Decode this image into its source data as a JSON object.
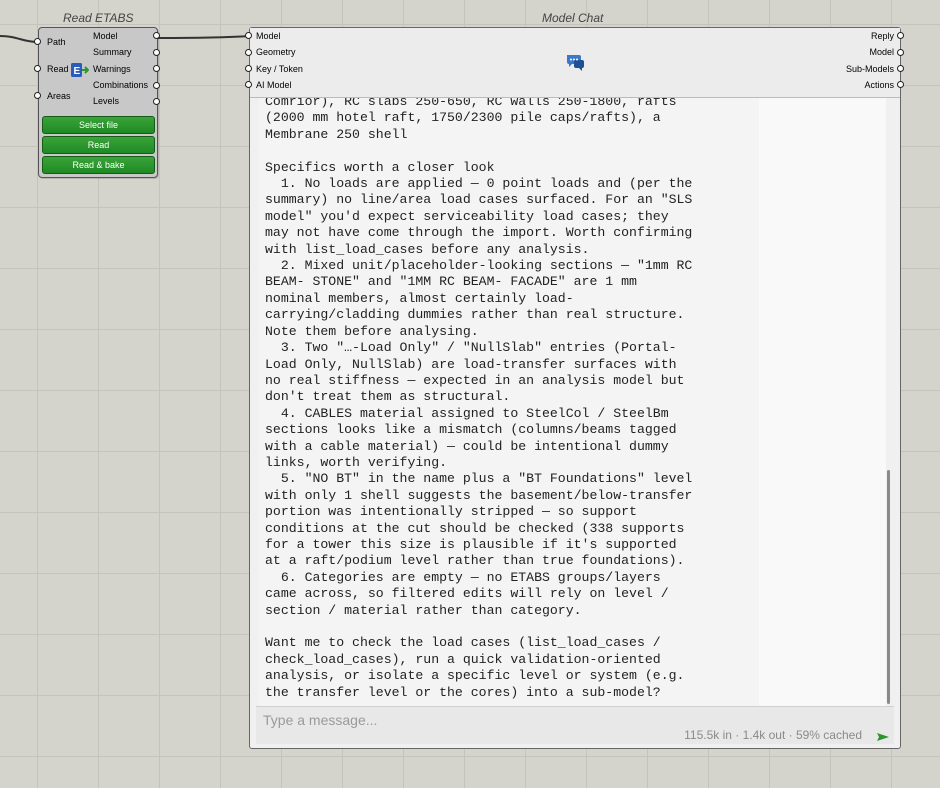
{
  "read_etabs": {
    "title": "Read ETABS",
    "inputs": [
      "Path",
      "Read",
      "Areas"
    ],
    "outputs": [
      "Model",
      "Summary",
      "Warnings",
      "Combinations",
      "Levels"
    ],
    "buttons": [
      "Select file",
      "Read",
      "Read & bake"
    ],
    "icon": "etabs-export-icon"
  },
  "model_chat": {
    "title": "Model Chat",
    "inputs": [
      "Model",
      "Geometry",
      "Key / Token",
      "AI Model"
    ],
    "outputs": [
      "Reply",
      "Model",
      "Sub-Models",
      "Actions"
    ],
    "icon": "chat-bubbles-icon",
    "transcript_lines": [
      "Comrior), RC slabs 250-650, RC walls 250-1800, rafts",
      "(2000 mm hotel raft, 1750/2300 pile caps/rafts), a",
      "Membrane 250 shell",
      "",
      "Specifics worth a closer look",
      "  1. No loads are applied — 0 point loads and (per the",
      "summary) no line/area load cases surfaced. For an \"SLS",
      "model\" you'd expect serviceability load cases; they",
      "may not have come through the import. Worth confirming",
      "with list_load_cases before any analysis.",
      "  2. Mixed unit/placeholder-looking sections — \"1mm RC",
      "BEAM- STONE\" and \"1MM RC BEAM- FACADE\" are 1 mm",
      "nominal members, almost certainly load-",
      "carrying/cladding dummies rather than real structure.",
      "Note them before analysing.",
      "  3. Two \"…-Load Only\" / \"NullSlab\" entries (Portal-",
      "Load Only, NullSlab) are load-transfer surfaces with",
      "no real stiffness — expected in an analysis model but",
      "don't treat them as structural.",
      "  4. CABLES material assigned to SteelCol / SteelBm",
      "sections looks like a mismatch (columns/beams tagged",
      "with a cable material) — could be intentional dummy",
      "links, worth verifying.",
      "  5. \"NO BT\" in the name plus a \"BT Foundations\" level",
      "with only 1 shell suggests the basement/below-transfer",
      "portion was intentionally stripped — so support",
      "conditions at the cut should be checked (338 supports",
      "for a tower this size is plausible if it's supported",
      "at a raft/podium level rather than true foundations).",
      "  6. Categories are empty — no ETABS groups/layers",
      "came across, so filtered edits will rely on level /",
      "section / material rather than category.",
      "",
      "Want me to check the load cases (list_load_cases /",
      "check_load_cases), run a quick validation-oriented",
      "analysis, or isolate a specific level or system (e.g.",
      "the transfer level or the cores) into a sub-model?"
    ],
    "message_placeholder": "Type a message...",
    "token_stats": "115.5k in · 1.4k out · 59% cached",
    "send_icon": "send-arrow-icon"
  },
  "colors": {
    "canvas": "#d4d4cc",
    "component_fill": "#c8c8c8",
    "button_green": "#2a962e",
    "scrollbar_thumb": "#8a8a8a"
  }
}
